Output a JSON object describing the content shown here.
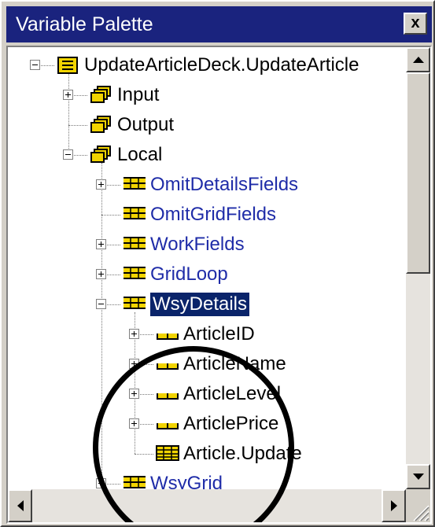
{
  "window": {
    "title": "Variable Palette",
    "close_label": "x"
  },
  "tree": [
    {
      "label": "UpdateArticleDeck.UpdateArticle",
      "icon": "deck-icon",
      "expander": "minus",
      "color": "black",
      "selected": false
    },
    {
      "label": "Input",
      "icon": "folders-icon",
      "expander": "plus",
      "color": "black",
      "selected": false
    },
    {
      "label": "Output",
      "icon": "folders-icon",
      "expander": "none",
      "color": "black",
      "selected": false
    },
    {
      "label": "Local",
      "icon": "folders-icon",
      "expander": "minus",
      "color": "black",
      "selected": false
    },
    {
      "label": "OmitDetailsFields",
      "icon": "structure-icon",
      "expander": "plus",
      "color": "blue",
      "selected": false
    },
    {
      "label": "OmitGridFields",
      "icon": "structure-icon",
      "expander": "none",
      "color": "blue",
      "selected": false
    },
    {
      "label": "WorkFields",
      "icon": "structure-icon",
      "expander": "plus",
      "color": "blue",
      "selected": false
    },
    {
      "label": "GridLoop",
      "icon": "structure-icon",
      "expander": "plus",
      "color": "blue",
      "selected": false
    },
    {
      "label": "WsyDetails",
      "icon": "structure-icon",
      "expander": "minus",
      "color": "blue",
      "selected": true
    },
    {
      "label": "ArticleID",
      "icon": "field-icon",
      "expander": "plus",
      "color": "black",
      "selected": false
    },
    {
      "label": "ArticleName",
      "icon": "field-icon",
      "expander": "plus",
      "color": "black",
      "selected": false
    },
    {
      "label": "ArticleLevel",
      "icon": "field-icon",
      "expander": "plus",
      "color": "black",
      "selected": false
    },
    {
      "label": "ArticlePrice",
      "icon": "field-icon",
      "expander": "plus",
      "color": "black",
      "selected": false
    },
    {
      "label": "Article.Update",
      "icon": "table-icon",
      "expander": "none",
      "color": "black",
      "selected": false
    },
    {
      "label": "WsyGrid",
      "icon": "structure-icon",
      "expander": "plus",
      "color": "blue",
      "selected": false
    }
  ],
  "colors": {
    "title_bar": "#1a237e",
    "selection": "#0a246a",
    "link_text": "#1f2ca8",
    "icon_yellow": "#f2d400",
    "annotation_circle": "#000000"
  }
}
